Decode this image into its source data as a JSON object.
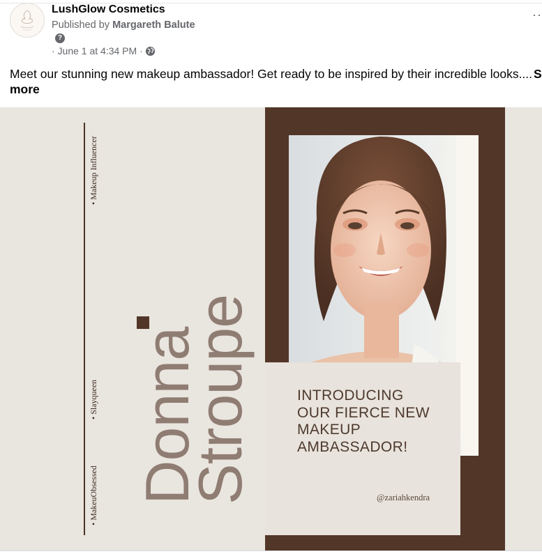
{
  "post": {
    "page_name": "LushGlow Cosmetics",
    "published_prefix": "Published by",
    "publisher": "Margareth Balute",
    "help_glyph": "?",
    "timestamp": "· June 1 at 4:34 PM ·",
    "privacy_icon": "globe-icon",
    "menu_icon": "more-dots-icon",
    "menu_glyph": "··",
    "caption": "Meet our stunning new makeup ambassador! Get ready to be inspired by their incredible looks....",
    "see_more_s": "S",
    "see_more": "more"
  },
  "poster": {
    "name_first": "Donna",
    "name_last": "Stroupe",
    "tag_top": "• Makeup Influencer",
    "tag_middle": "• Slayqueen",
    "tag_bottom": "• MakeuObsessed",
    "intro_lines": [
      "INTRODUCING",
      "OUR FIERCE NEW",
      "MAKEUP",
      "AMBASSADOR!"
    ],
    "handle": "@zariahkendra",
    "colors": {
      "background": "#e9e5df",
      "brown": "#523627",
      "name_text": "#8f7c72",
      "card": "#e8e3dc"
    }
  }
}
